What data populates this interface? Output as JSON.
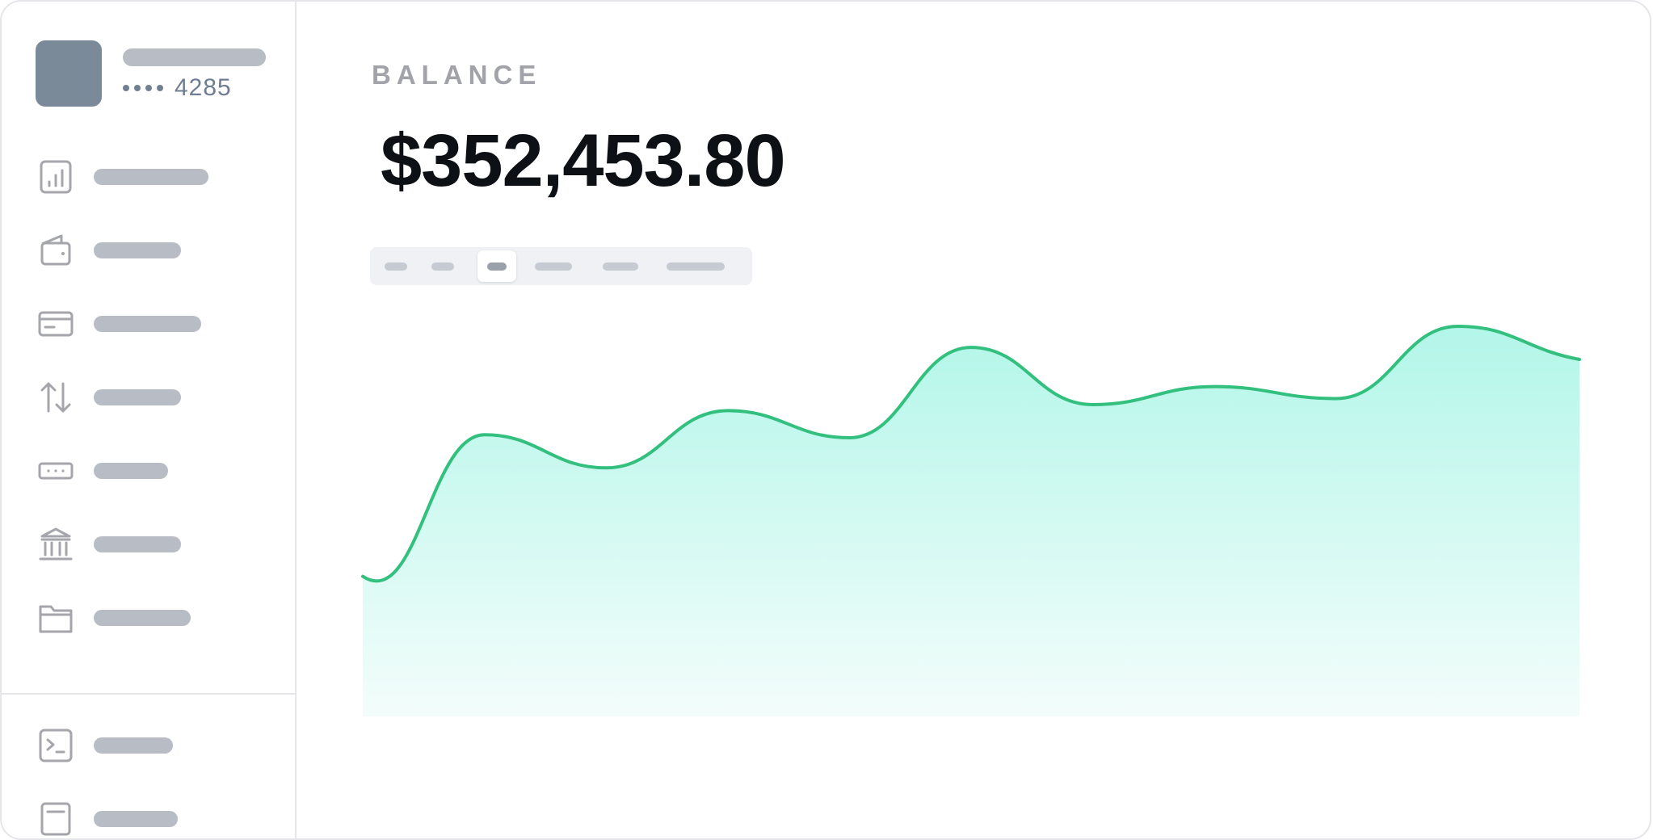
{
  "account": {
    "masked_prefix": "••••",
    "last4": "4285"
  },
  "balance": {
    "label": "BALANCE",
    "amount": "$352,453.80"
  },
  "nav": {
    "items": [
      {
        "icon": "bar-chart-icon",
        "name": "sidebar-item-dashboard"
      },
      {
        "icon": "wallet-icon",
        "name": "sidebar-item-wallet"
      },
      {
        "icon": "credit-card-icon",
        "name": "sidebar-item-cards"
      },
      {
        "icon": "transfer-arrows-icon",
        "name": "sidebar-item-transfers"
      },
      {
        "icon": "password-field-icon",
        "name": "sidebar-item-credentials"
      },
      {
        "icon": "bank-icon",
        "name": "sidebar-item-bank"
      },
      {
        "icon": "folder-icon",
        "name": "sidebar-item-documents"
      }
    ],
    "bottom_items": [
      {
        "icon": "terminal-icon",
        "name": "sidebar-item-developer"
      },
      {
        "icon": "document-icon",
        "name": "sidebar-item-statements"
      }
    ]
  },
  "range_tabs": {
    "count": 6,
    "selected_index": 2
  },
  "colors": {
    "line": "#33c07e",
    "fill_top": "#b3f6e9",
    "fill_bottom": "#f3fdfb",
    "avatar": "#7b8a99",
    "placeholder": "#b7bcc5"
  },
  "chart_data": {
    "type": "area",
    "x": [
      0,
      1,
      2,
      3,
      4,
      5,
      6,
      7,
      8,
      9,
      10
    ],
    "values": [
      0.17,
      0.64,
      0.53,
      0.72,
      0.63,
      0.93,
      0.74,
      0.8,
      0.76,
      1.0,
      0.89
    ],
    "grid": false,
    "legend": "none"
  }
}
